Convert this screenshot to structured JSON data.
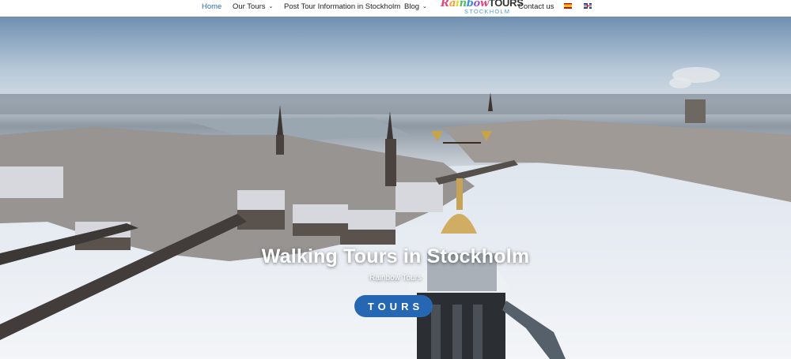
{
  "nav": {
    "items": [
      {
        "label": "Home",
        "active": true,
        "has_dropdown": false
      },
      {
        "label": "Our Tours",
        "active": false,
        "has_dropdown": true
      },
      {
        "label": "Post Tour Information in Stockholm",
        "active": false,
        "has_dropdown": false
      },
      {
        "label": "Blog",
        "active": false,
        "has_dropdown": true
      },
      {
        "label": "Contact us",
        "active": false,
        "has_dropdown": false
      }
    ],
    "chevron": "⌄",
    "logo": {
      "top": "Rainbow",
      "tours": "TOURS",
      "bottom": "STOCKHOLM"
    },
    "languages": [
      {
        "icon": "spain-flag-icon"
      },
      {
        "icon": "uk-flag-icon"
      }
    ],
    "active_color": "#2b6cb5"
  },
  "hero": {
    "title": "Walking Tours in Stockholm",
    "subtitle": "Rainbow Tours",
    "button_label": "TOURS",
    "button_color": "#2567b3"
  }
}
